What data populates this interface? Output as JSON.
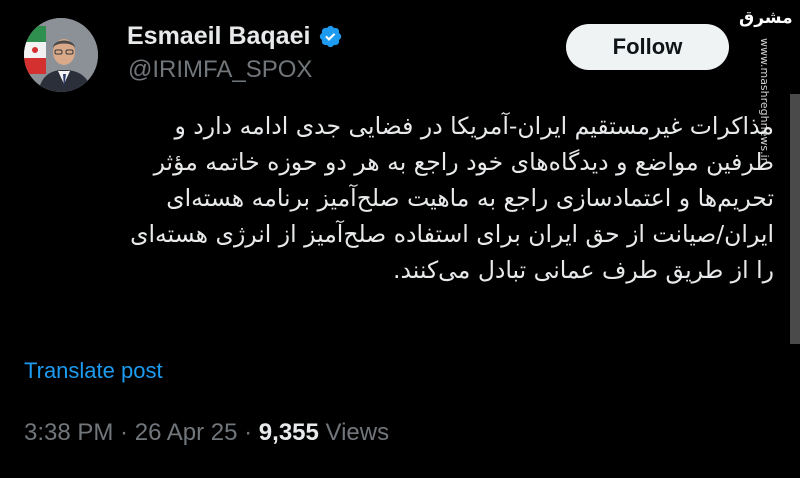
{
  "author": {
    "display_name": "Esmaeil Baqaei",
    "handle": "@IRIMFA_SPOX",
    "verified": true,
    "verified_icon": "verified-badge-icon"
  },
  "actions": {
    "follow_label": "Follow"
  },
  "watermark": {
    "logo_text": "مشرق",
    "site": "www.mashreghnews.ir"
  },
  "post": {
    "lines": [
      "مذاکرات غیرمستقیم ایران-آمریکا در فضایی جدی ادامه دارد و",
      "طرفین مواضع و دیدگاه‌های خود راجع به هر دو حوزه خاتمه مؤثر",
      "تحریم‌ها و اعتمادسازی راجع به ماهیت صلح‌آمیز برنامه هسته‌ای",
      "ایران/صیانت از حق ایران برای استفاده صلح‌آمیز از انرژی هسته‌ای",
      "را از طریق طرف عمانی تبادل می‌کنند."
    ],
    "translate_label": "Translate post"
  },
  "meta": {
    "time": "3:38 PM",
    "separator": " · ",
    "date": "26 Apr 25",
    "views_count": "9,355",
    "views_label": " Views"
  },
  "colors": {
    "background": "#000000",
    "text": "#e7e9ea",
    "secondary": "#71767b",
    "link": "#1d9bf0",
    "verified": "#1d9bf0",
    "button_bg": "#eff3f4"
  }
}
